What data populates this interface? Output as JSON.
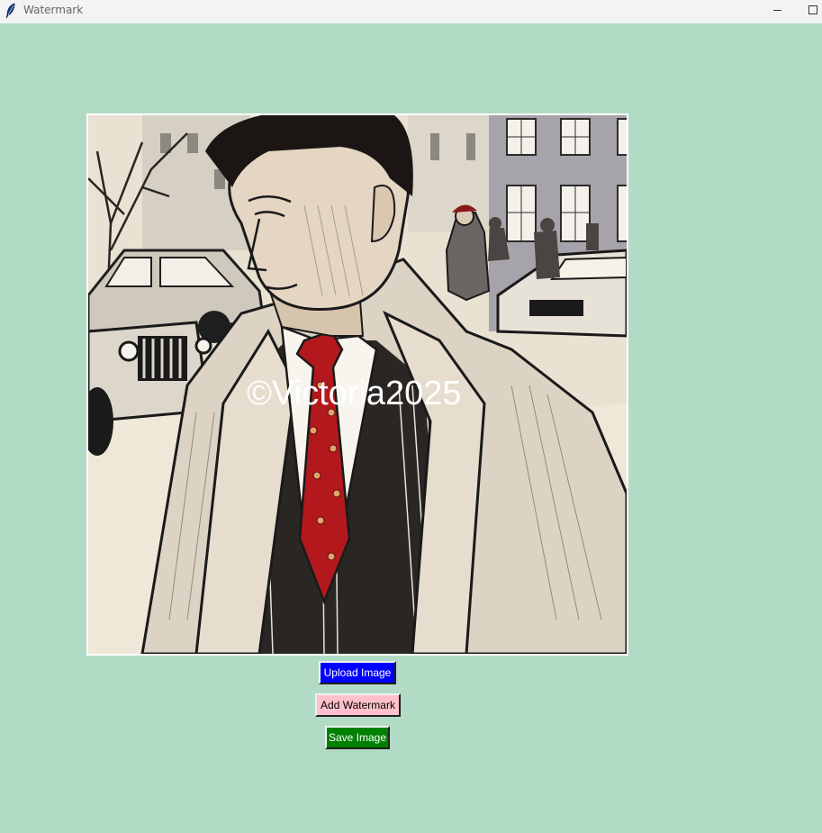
{
  "window": {
    "title": "Watermark",
    "background_color": "#b2dbc6",
    "app_icon": "feather-icon",
    "controls": {
      "minimize_icon": "minimize-icon",
      "maximize_icon": "maximize-icon"
    }
  },
  "image": {
    "watermark_text": "©Victoria2025",
    "watermark_color": "#ffffff"
  },
  "buttons": {
    "upload_label": "Upload Image",
    "upload_color": "#0000ff",
    "add_watermark_label": "Add Watermark",
    "add_watermark_color": "#ffc0cb",
    "save_label": "Save Image",
    "save_color": "#008000"
  }
}
